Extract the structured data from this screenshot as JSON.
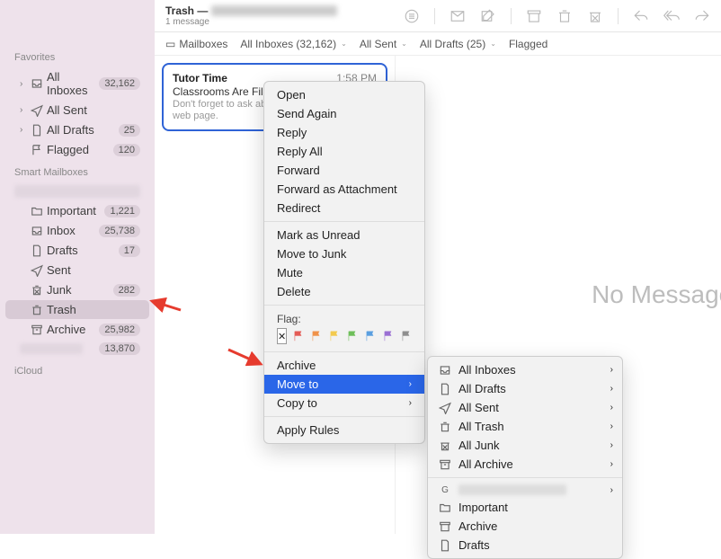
{
  "header": {
    "title_prefix": "Trash —",
    "sub": "1 message"
  },
  "favbar": {
    "mailboxes": "Mailboxes",
    "allinboxes": "All Inboxes (32,162)",
    "allsent": "All Sent",
    "alldrafts": "All Drafts (25)",
    "flagged": "Flagged"
  },
  "sidebar": {
    "favorites_title": "Favorites",
    "smart_title": "Smart Mailboxes",
    "icloud_title": "iCloud",
    "items": {
      "allinboxes": {
        "label": "All Inboxes",
        "badge": "32,162"
      },
      "allsent": {
        "label": "All Sent",
        "badge": ""
      },
      "alldrafts": {
        "label": "All Drafts",
        "badge": "25"
      },
      "flagged": {
        "label": "Flagged",
        "badge": "120"
      },
      "important": {
        "label": "Important",
        "badge": "1,221"
      },
      "inbox": {
        "label": "Inbox",
        "badge": "25,738"
      },
      "drafts": {
        "label": "Drafts",
        "badge": "17"
      },
      "sent": {
        "label": "Sent",
        "badge": ""
      },
      "junk": {
        "label": "Junk",
        "badge": "282"
      },
      "trash": {
        "label": "Trash",
        "badge": ""
      },
      "archive": {
        "label": "Archive",
        "badge": "25,982"
      },
      "other": {
        "label": "",
        "badge": "13,870"
      }
    }
  },
  "message": {
    "from": "Tutor Time",
    "time": "1:58 PM",
    "subject": "Classrooms Are Filling Up",
    "preview": "Don't forget to ask about our options! View as web page."
  },
  "preview_pane": "No Message Selected",
  "context1": {
    "open": "Open",
    "send_again": "Send Again",
    "reply": "Reply",
    "reply_all": "Reply All",
    "forward": "Forward",
    "forward_att": "Forward as Attachment",
    "redirect": "Redirect",
    "mark_unread": "Mark as Unread",
    "move_junk": "Move to Junk",
    "mute": "Mute",
    "delete": "Delete",
    "flag_title": "Flag:",
    "flag_colors": [
      "#e45b55",
      "#f0924a",
      "#f3ca4e",
      "#6ebf5a",
      "#5a9fe0",
      "#9a6fd3",
      "#8e8e8e"
    ],
    "archive": "Archive",
    "move_to": "Move to",
    "copy_to": "Copy to",
    "apply_rules": "Apply Rules"
  },
  "context2": {
    "all_inboxes": "All Inboxes",
    "all_drafts": "All Drafts",
    "all_sent": "All Sent",
    "all_trash": "All Trash",
    "all_junk": "All Junk",
    "all_archive": "All Archive",
    "important": "Important",
    "archive": "Archive",
    "drafts": "Drafts"
  }
}
